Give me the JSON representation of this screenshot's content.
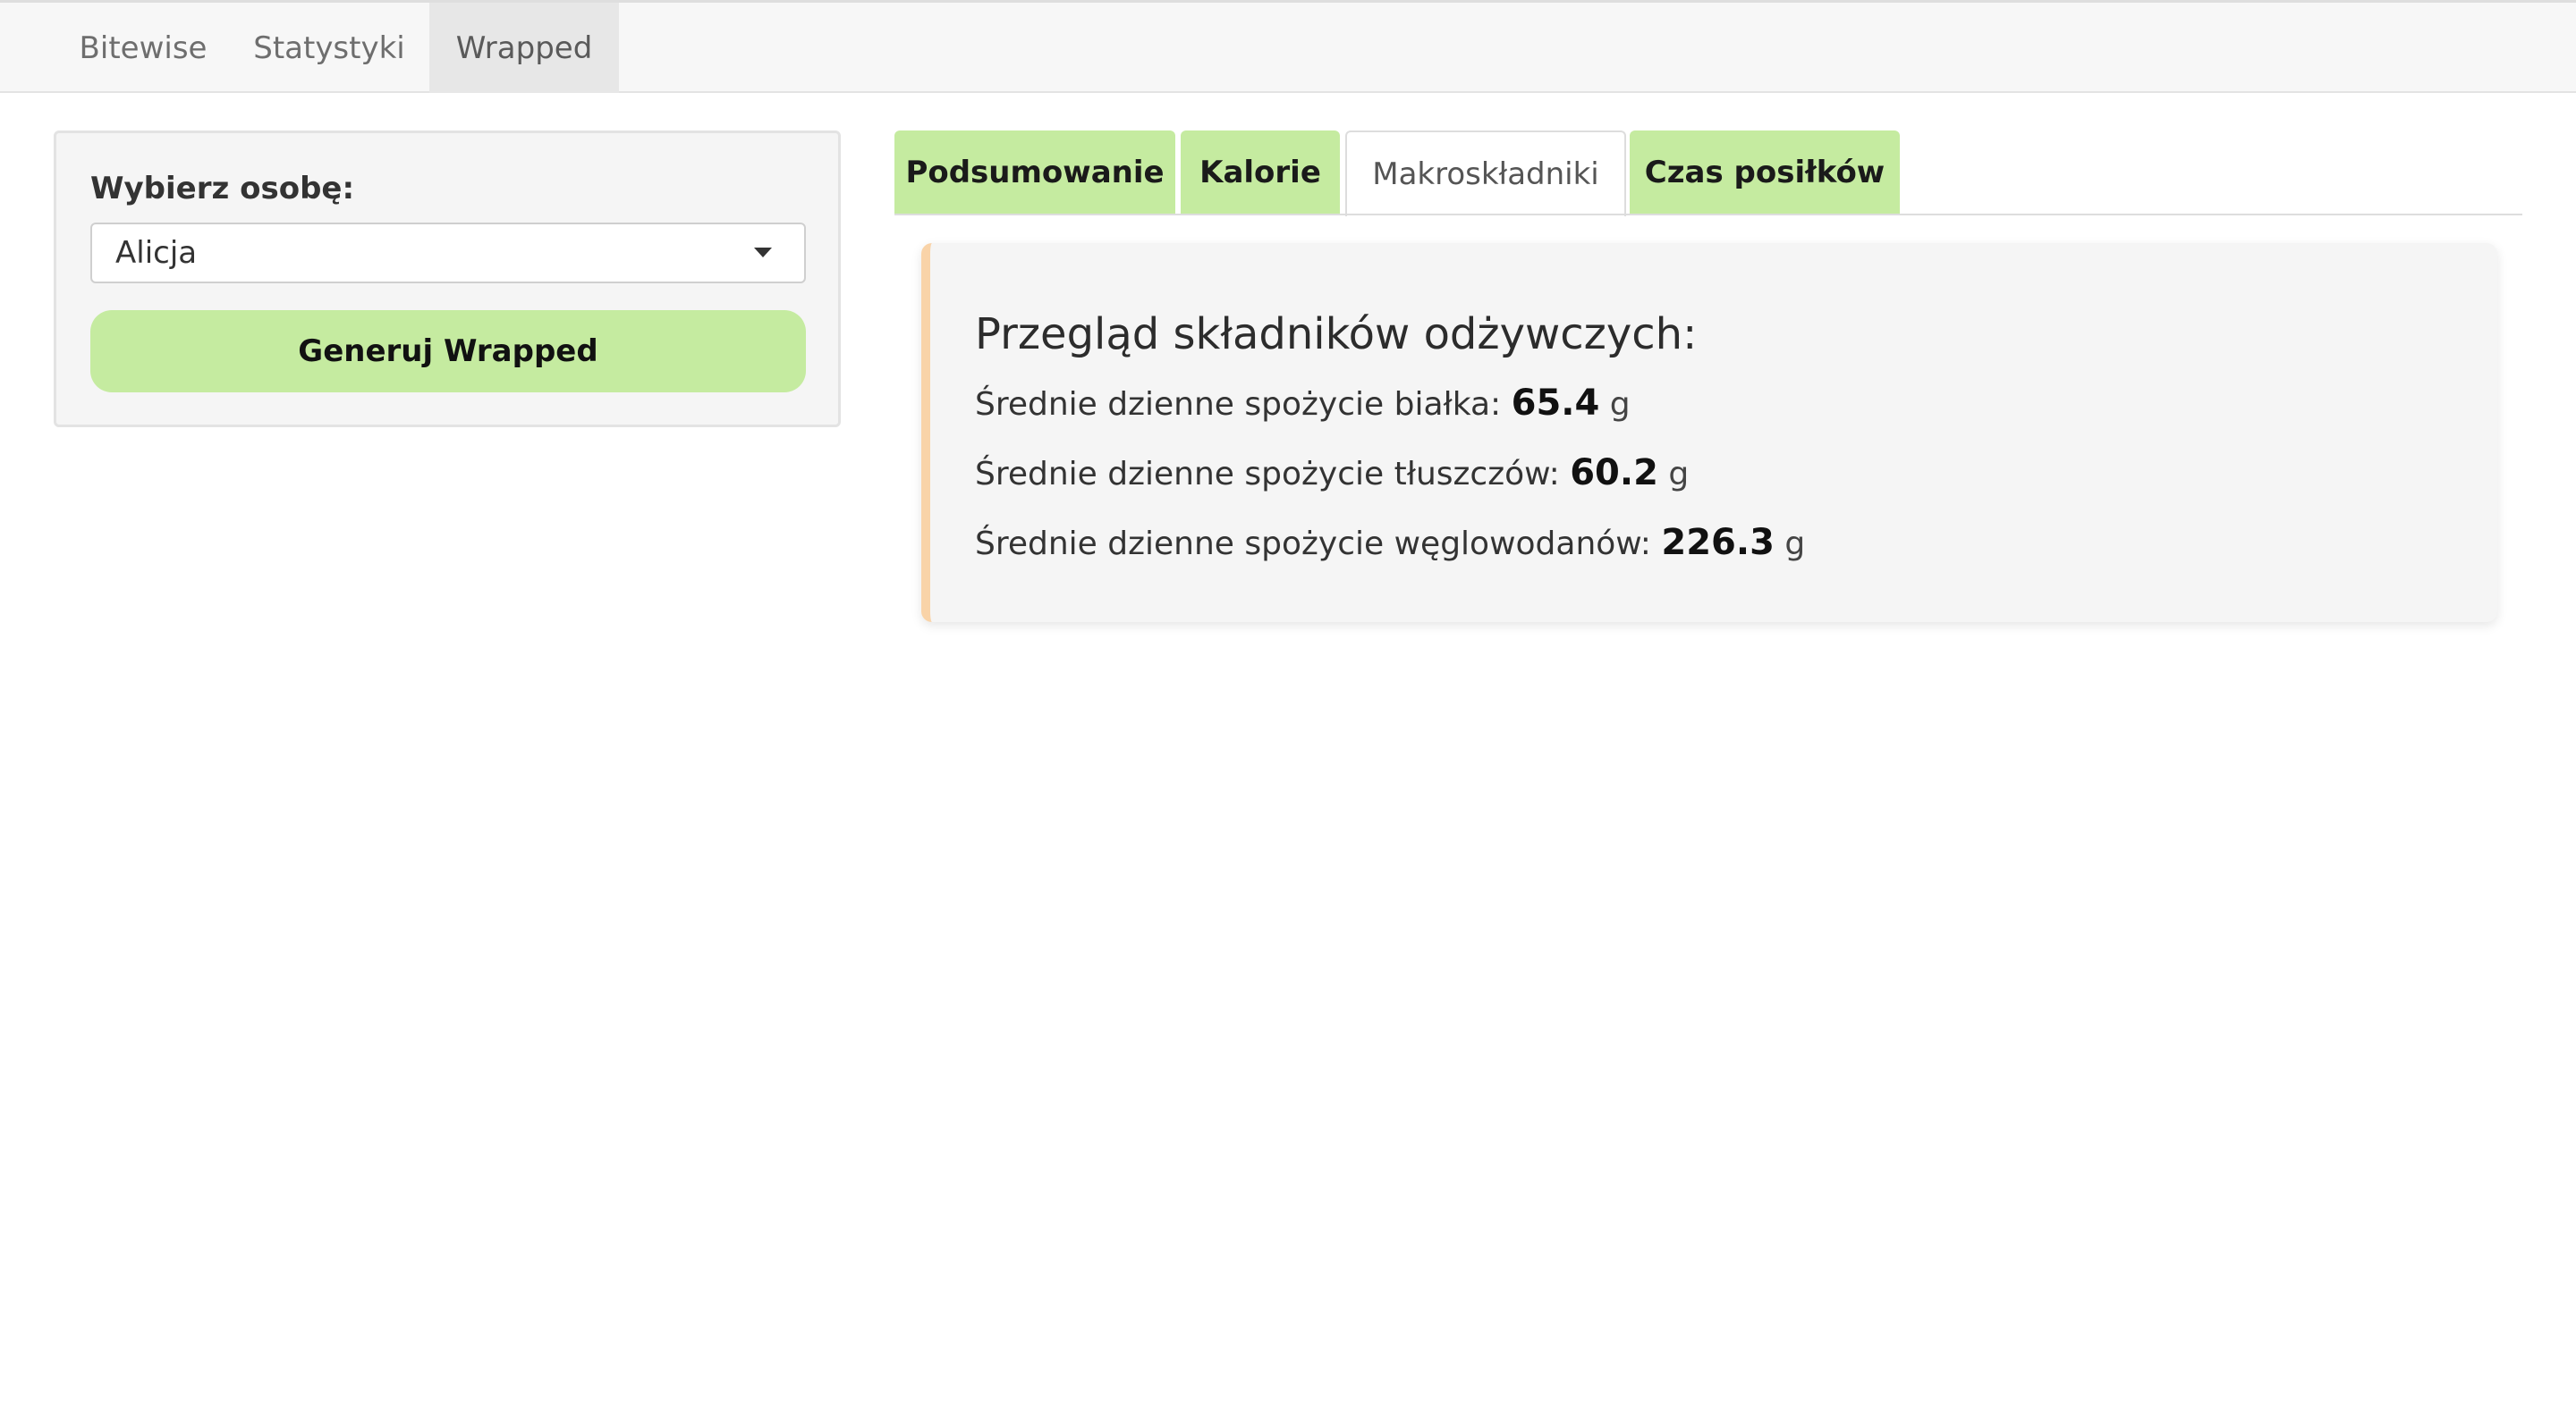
{
  "navbar": {
    "items": [
      {
        "label": "Bitewise",
        "active": false
      },
      {
        "label": "Statystyki",
        "active": false
      },
      {
        "label": "Wrapped",
        "active": true
      }
    ]
  },
  "sidebar": {
    "select_label": "Wybierz osobę:",
    "selected_person": "Alicja",
    "generate_button": "Generuj Wrapped"
  },
  "tabs": [
    {
      "label": "Podsumowanie",
      "active": false
    },
    {
      "label": "Kalorie",
      "active": false
    },
    {
      "label": "Makroskładniki",
      "active": true
    },
    {
      "label": "Czas posiłków",
      "active": false
    }
  ],
  "card": {
    "title": "Przegląd składników odżywczych:",
    "stats": [
      {
        "label": "Średnie dzienne spożycie białka:",
        "value": "65.4",
        "unit": "g"
      },
      {
        "label": "Średnie dzienne spożycie tłuszczów:",
        "value": "60.2",
        "unit": "g"
      },
      {
        "label": "Średnie dzienne spożycie węglowodanów:",
        "value": "226.3",
        "unit": "g"
      }
    ]
  },
  "colors": {
    "accent_green": "#c5eba0",
    "card_border": "#f9d3a8",
    "panel_bg": "#f5f5f5"
  }
}
